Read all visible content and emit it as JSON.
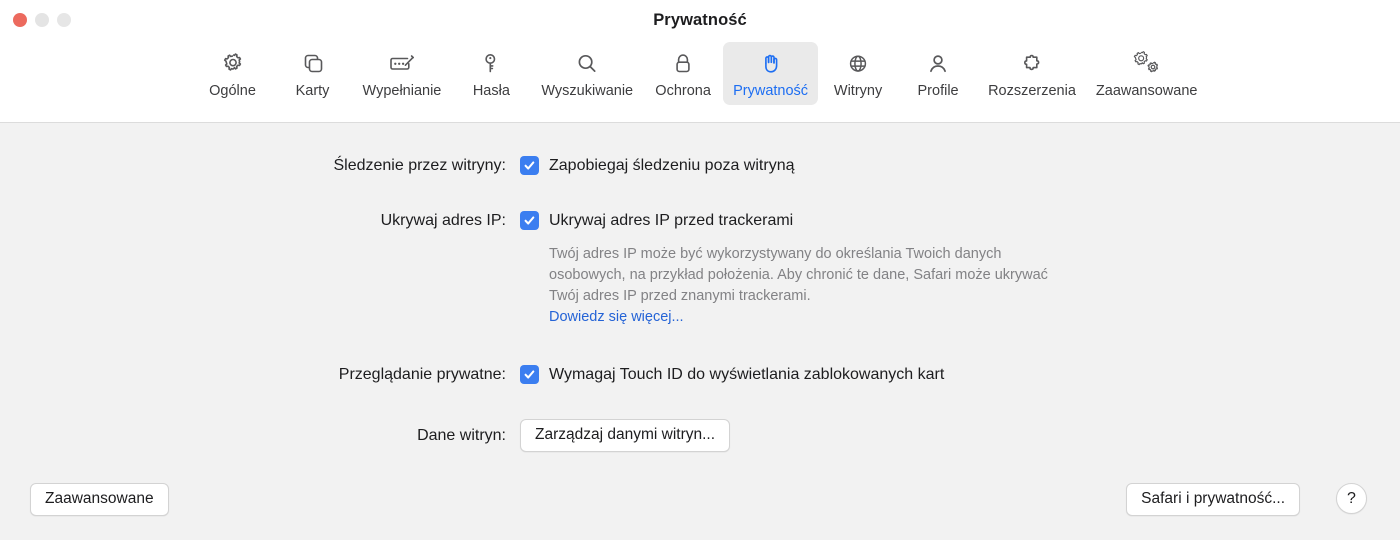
{
  "window": {
    "title": "Prywatność",
    "traffic_lights": [
      "close",
      "minimize",
      "zoom"
    ]
  },
  "toolbar": {
    "items": [
      {
        "label": "Ogólne",
        "icon": "gear-icon",
        "selected": false
      },
      {
        "label": "Karty",
        "icon": "tabs-icon",
        "selected": false
      },
      {
        "label": "Wypełnianie",
        "icon": "autofill-icon",
        "selected": false
      },
      {
        "label": "Hasła",
        "icon": "key-icon",
        "selected": false
      },
      {
        "label": "Wyszukiwanie",
        "icon": "search-icon",
        "selected": false
      },
      {
        "label": "Ochrona",
        "icon": "lock-icon",
        "selected": false
      },
      {
        "label": "Prywatność",
        "icon": "hand-icon",
        "selected": true
      },
      {
        "label": "Witryny",
        "icon": "globe-icon",
        "selected": false
      },
      {
        "label": "Profile",
        "icon": "person-icon",
        "selected": false
      },
      {
        "label": "Rozszerzenia",
        "icon": "puzzle-icon",
        "selected": false
      },
      {
        "label": "Zaawansowane",
        "icon": "double-gear-icon",
        "selected": false
      }
    ]
  },
  "main": {
    "tracking": {
      "label": "Śledzenie przez witryny:",
      "checkbox_label": "Zapobiegaj śledzeniu poza witryną",
      "checked": true
    },
    "hide_ip": {
      "label": "Ukrywaj adres IP:",
      "checkbox_label": "Ukrywaj adres IP przed trackerami",
      "checked": true,
      "description": "Twój adres IP może być wykorzystywany do określania Twoich danych osobowych, na przykład położenia. Aby chronić te dane, Safari może ukrywać Twój adres IP przed znanymi trackerami.",
      "link_label": "Dowiedz się więcej..."
    },
    "private_browsing": {
      "label": "Przeglądanie prywatne:",
      "checkbox_label": "Wymagaj Touch ID do wyświetlania zablokowanych kart",
      "checked": true
    },
    "site_data": {
      "label": "Dane witryn:",
      "button_label": "Zarządzaj danymi witryn..."
    }
  },
  "footer": {
    "advanced_label": "Zaawansowane",
    "safari_privacy_label": "Safari i prywatność...",
    "help_label": "?"
  },
  "colors": {
    "accent": "#3b7ef0",
    "selected_tab_text": "#1d6ef2",
    "selected_tab_bg": "#eaeaea",
    "link": "#2463d6",
    "content_bg": "#f2f2f2",
    "toolbar_bg": "#ffffff",
    "close_button": "#ec6a5e"
  }
}
